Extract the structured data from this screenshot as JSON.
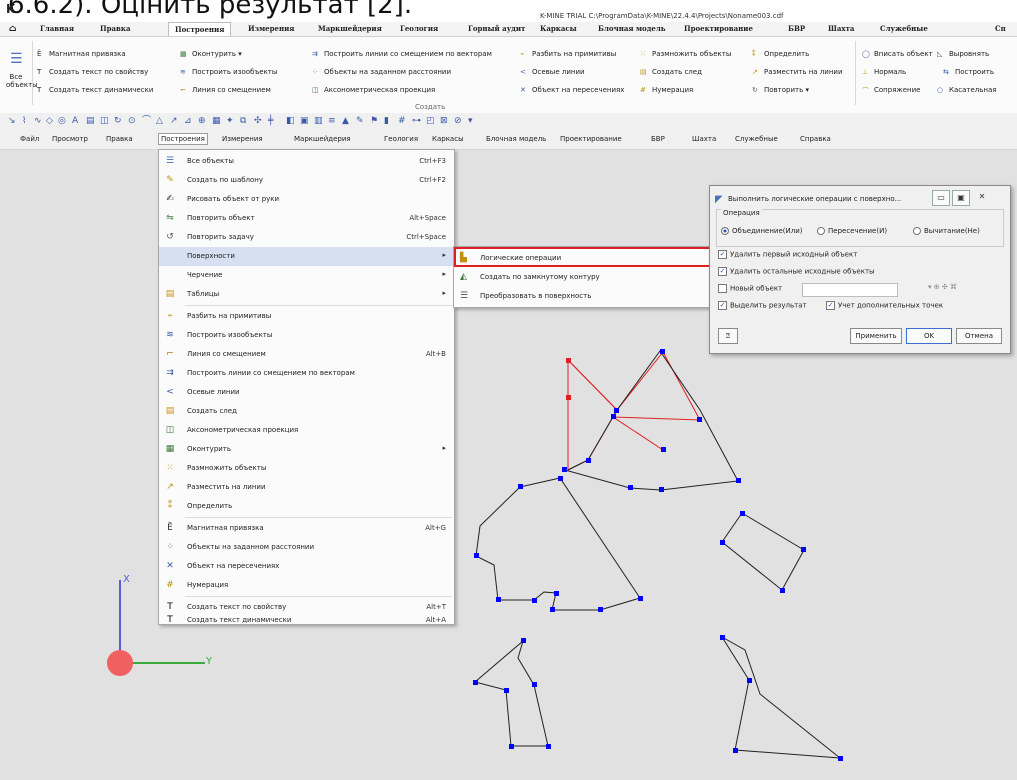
{
  "caption_text": "6.6.2). Оцінить результат [2].",
  "window": {
    "app_letter": "K",
    "title": "K-MINE TRIAL C:\\ProgramData\\K-MINE\\22.4.4\\Projects\\Noname003.cdf"
  },
  "ribbon_tabs": [
    "Главная",
    "Правка",
    "Построения",
    "Измерения",
    "Маркшейдерия",
    "Геология",
    "Горный аудит",
    "Каркасы",
    "Блочная модель",
    "Проектирование",
    "БВР",
    "Шахта",
    "Служебные",
    "Сп"
  ],
  "ribbon": {
    "all_objects": "Все объекты",
    "items": [
      "Магнитная привязка",
      "Создать текст по свойству",
      "Создать текст динамически",
      "Оконтурить",
      "Построить изообъекты",
      "Линия со смещением",
      "Построить линии со смещением по векторам",
      "Объекты на заданном расстоянии",
      "Аксонометрическая проекция",
      "Разбить на примитивы",
      "Осевые линии",
      "Объект на пересечениях",
      "Размножить объекты",
      "Создать след",
      "Нумерация",
      "Определить",
      "Разместить на линии",
      "Повторить",
      "Вписать объект",
      "Нормаль",
      "Сопряжение",
      "Выровнять",
      "Построить",
      "Касательная"
    ],
    "group_label": "Создать"
  },
  "menubar": [
    "Файл",
    "Просмотр",
    "Правка",
    "Построения",
    "Измерения",
    "Маркшейдерия",
    "Геология",
    "Каркасы",
    "Блочная модель",
    "Проектирование",
    "БВР",
    "Шахта",
    "Служебные",
    "Справка"
  ],
  "menu": [
    {
      "label": "Все объекты",
      "shortcut": "Ctrl+F3",
      "icon": "all-objects-icon"
    },
    {
      "label": "Создать по шаблону",
      "shortcut": "Ctrl+F2",
      "icon": "template-icon"
    },
    {
      "label": "Рисовать объект от руки",
      "shortcut": "",
      "icon": "freehand-icon"
    },
    {
      "label": "Повторить объект",
      "shortcut": "Alt+Space",
      "icon": "repeat-object-icon"
    },
    {
      "label": "Повторить задачу",
      "shortcut": "Ctrl+Space",
      "icon": "repeat-task-icon"
    },
    {
      "label": "Поверхности",
      "shortcut": "",
      "icon": "",
      "submenu": true
    },
    {
      "label": "Черчение",
      "shortcut": "",
      "icon": "",
      "submenu": true
    },
    {
      "label": "Таблицы",
      "shortcut": "",
      "icon": "table-icon",
      "submenu": true
    },
    {
      "label": "Разбить на примитивы",
      "shortcut": "",
      "icon": "split-icon"
    },
    {
      "label": "Построить изообъекты",
      "shortcut": "",
      "icon": "iso-icon"
    },
    {
      "label": "Линия со смещением",
      "shortcut": "Alt+B",
      "icon": "offset-line-icon"
    },
    {
      "label": "Построить линии со смещением по векторам",
      "shortcut": "",
      "icon": "vector-offset-icon"
    },
    {
      "label": "Осевые линии",
      "shortcut": "",
      "icon": "axial-lines-icon"
    },
    {
      "label": "Создать след",
      "shortcut": "",
      "icon": "trace-icon"
    },
    {
      "label": "Аксонометрическая проекция",
      "shortcut": "",
      "icon": "axonometric-icon"
    },
    {
      "label": "Оконтурить",
      "shortcut": "",
      "icon": "contour-icon",
      "submenu": true
    },
    {
      "label": "Размножить объекты",
      "shortcut": "",
      "icon": "multiply-icon"
    },
    {
      "label": "Разместить на линии",
      "shortcut": "",
      "icon": "place-on-line-icon"
    },
    {
      "label": "Определить",
      "shortcut": "",
      "icon": "define-icon"
    },
    {
      "label": "Магнитная привязка",
      "shortcut": "Alt+G",
      "icon": "magnet-icon"
    },
    {
      "label": "Объекты на заданном расстоянии",
      "shortcut": "",
      "icon": "distance-icon"
    },
    {
      "label": "Объект на пересечениях",
      "shortcut": "",
      "icon": "intersection-icon"
    },
    {
      "label": "Нумерация",
      "shortcut": "",
      "icon": "numbering-icon"
    },
    {
      "label": "Создать текст по свойству",
      "shortcut": "Alt+T",
      "icon": "text-property-icon"
    },
    {
      "label": "Создать текст динамически",
      "shortcut": "Alt+A",
      "icon": "text-dynamic-icon"
    }
  ],
  "submenu": [
    {
      "label": "Логические операции",
      "icon": "logical-ops-icon"
    },
    {
      "label": "Создать по замкнутому контуру",
      "icon": "closed-contour-icon"
    },
    {
      "label": "Преобразовать в поверхность",
      "icon": "to-surface-icon"
    }
  ],
  "dialog": {
    "title": "Выполнить логические операции с поверхно...",
    "operation_legend": "Операция",
    "op_union": "Объединение(Или)",
    "op_intersection": "Пересечение(И)",
    "op_subtraction": "Вычитание(Не)",
    "delete_first": "Удалить первый исходный объект",
    "delete_others": "Удалить остальные исходные объекты",
    "new_object": "Новый объект",
    "highlight_result": "Выделить результат",
    "extra_points": "Учет дополнительных точек",
    "apply": "Применить",
    "ok": "OK",
    "cancel": "Отмена"
  },
  "axis": {
    "x_label": "X",
    "y_label": "Y"
  },
  "colors": {
    "vertex": "#0000ff",
    "selected_edge": "#e02020",
    "edge": "#000000",
    "axis_x": "#5a5ae0",
    "axis_y": "#3aaa3a",
    "origin": "#f06060",
    "highlight_box": "#e02020"
  }
}
